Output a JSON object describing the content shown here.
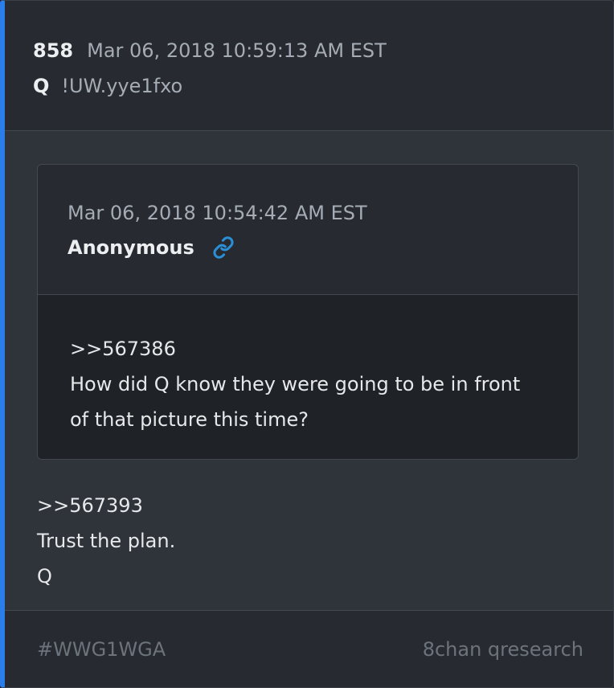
{
  "post": {
    "number": "858",
    "date": "Mar 06, 2018 10:59:13 AM EST",
    "author": "Q",
    "tripcode": "!UW.yye1fxo"
  },
  "quoted": {
    "date": "Mar 06, 2018 10:54:42 AM EST",
    "author": "Anonymous",
    "link_icon": "link-icon",
    "lines": [
      ">>567386",
      "How did Q know they were going to be in front",
      "of that picture this time?"
    ]
  },
  "body": {
    "lines": [
      ">>567393",
      "Trust the plan.",
      "Q"
    ]
  },
  "footer": {
    "tag": "#WWG1WGA",
    "source": "8chan qresearch"
  },
  "colors": {
    "accent": "#2b7de9",
    "link": "#2b8fd6"
  }
}
